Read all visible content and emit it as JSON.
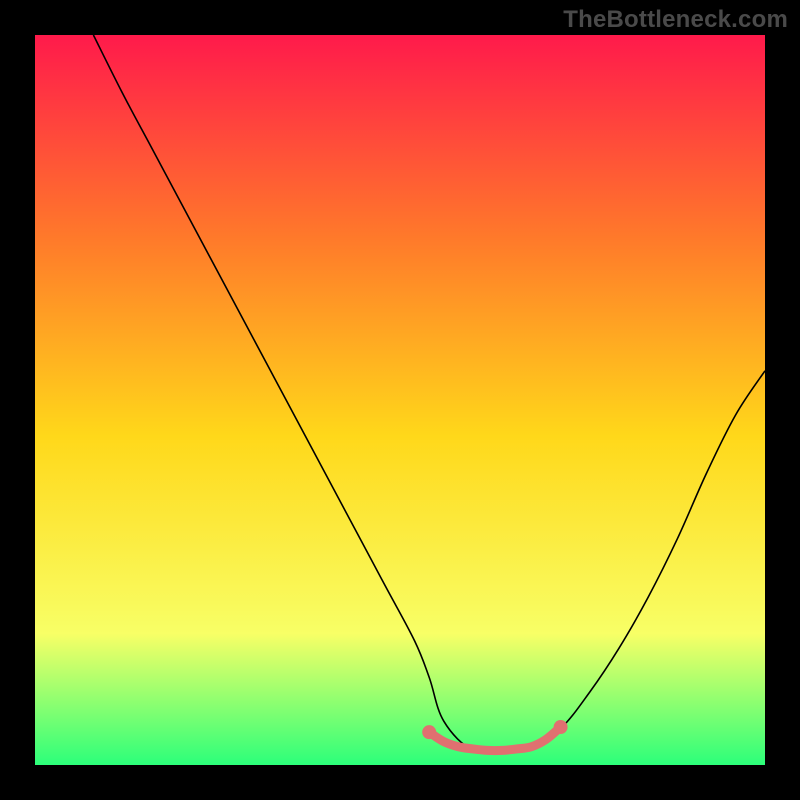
{
  "watermark": "TheBottleneck.com",
  "chart_data": {
    "type": "line",
    "title": "",
    "xlabel": "",
    "ylabel": "",
    "xlim": [
      0,
      100
    ],
    "ylim": [
      0,
      100
    ],
    "background_gradient": {
      "top": "#ff1a4b",
      "mid_upper": "#ff7a2a",
      "mid": "#ffd81a",
      "mid_lower": "#f8ff66",
      "bottom": "#2cff7a"
    },
    "series": [
      {
        "name": "bottleneck-curve",
        "color": "#000000",
        "x": [
          8,
          12,
          16,
          20,
          24,
          28,
          32,
          36,
          40,
          44,
          48,
          52,
          54,
          56,
          60,
          64,
          68,
          72,
          76,
          80,
          84,
          88,
          92,
          96,
          100
        ],
        "values": [
          100,
          92,
          84.5,
          77,
          69.5,
          62,
          54.5,
          47,
          39.5,
          32,
          24.5,
          17,
          12,
          6,
          2,
          2,
          2.5,
          5,
          10,
          16,
          23,
          31,
          40,
          48,
          54
        ]
      },
      {
        "name": "highlight-segment",
        "color": "#e07070",
        "x": [
          54,
          56,
          58,
          60,
          62,
          64,
          66,
          68,
          70,
          72
        ],
        "values": [
          4.5,
          3.2,
          2.5,
          2.2,
          2.0,
          2.0,
          2.2,
          2.5,
          3.5,
          5.2
        ]
      }
    ],
    "highlight_points": {
      "color": "#e07070",
      "x": [
        54,
        72
      ],
      "values": [
        4.5,
        5.2
      ]
    }
  }
}
